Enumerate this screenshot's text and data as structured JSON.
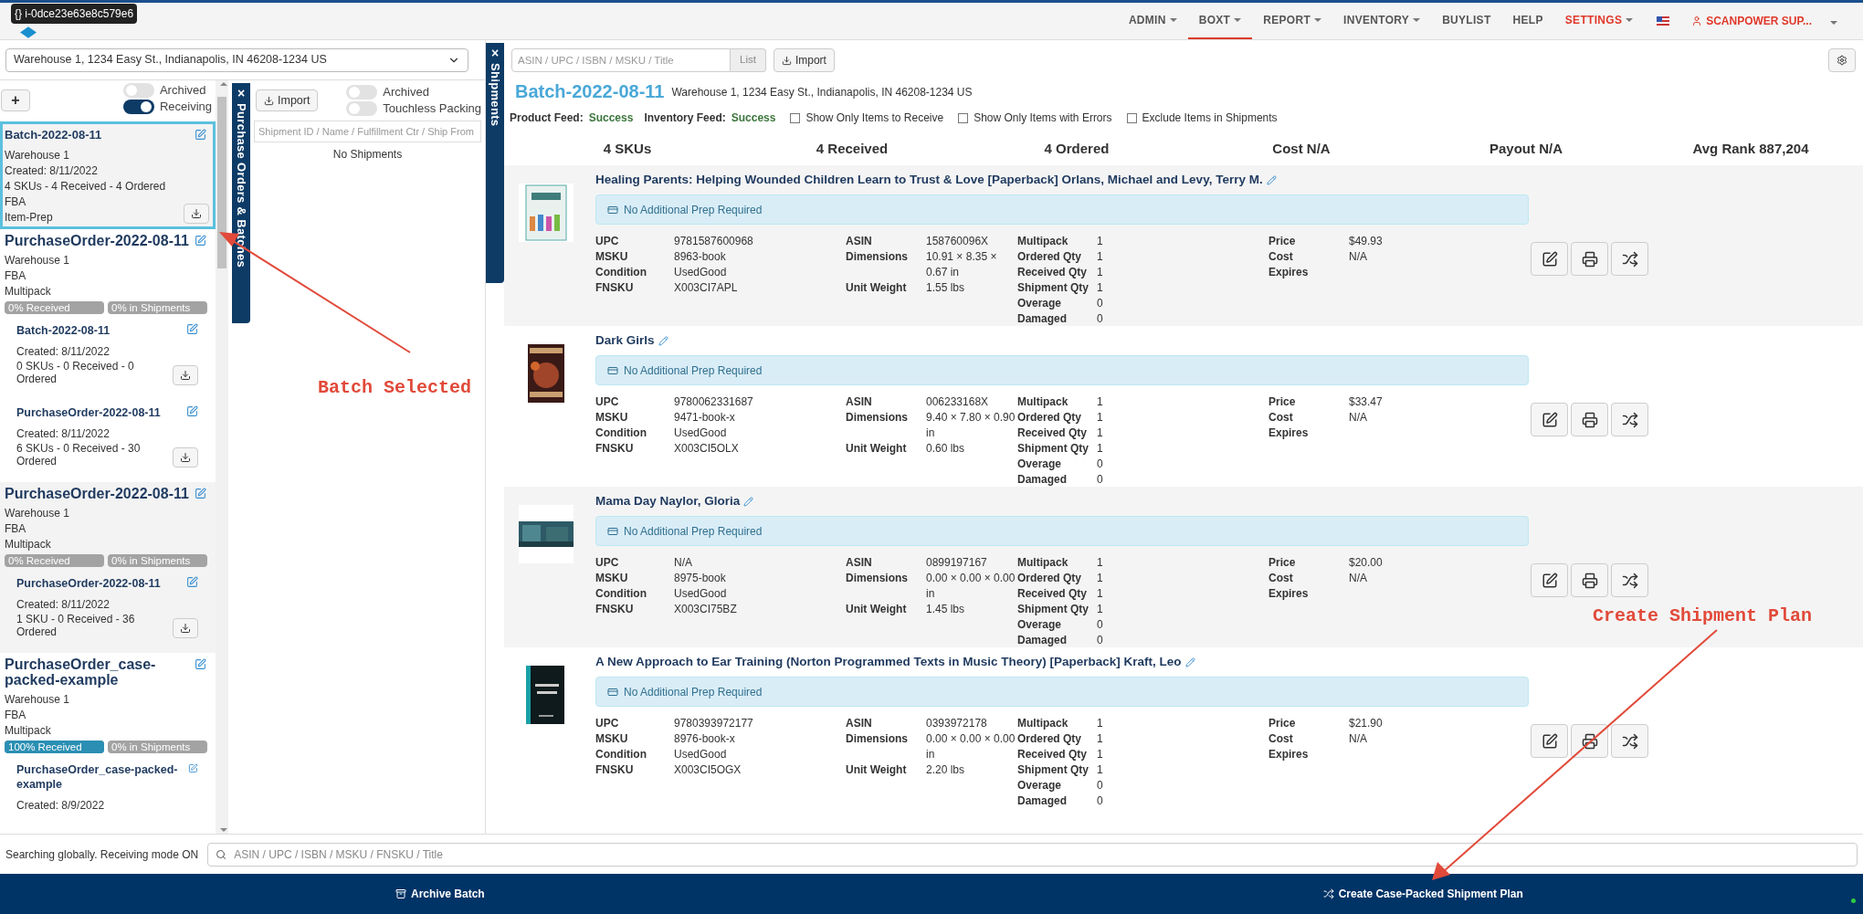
{
  "tooltip": "{} i-0dce23e63e8c579e6",
  "nav": {
    "menus": [
      {
        "label": "ADMIN",
        "dropdown": true,
        "selected": false,
        "color": "#555555"
      },
      {
        "label": "BOXT",
        "dropdown": true,
        "selected": true,
        "color": "#555555"
      },
      {
        "label": "REPORT",
        "dropdown": true,
        "selected": false,
        "color": "#555555"
      },
      {
        "label": "INVENTORY",
        "dropdown": true,
        "selected": false,
        "color": "#555555"
      },
      {
        "label": "BUYLIST",
        "dropdown": false,
        "selected": false,
        "color": "#555555"
      },
      {
        "label": "HELP",
        "dropdown": false,
        "selected": false,
        "color": "#555555"
      },
      {
        "label": "SETTINGS",
        "dropdown": true,
        "selected": false,
        "color": "#e0392b"
      }
    ],
    "user": {
      "label": "SCANPOWER SUP...",
      "dropdown": true
    }
  },
  "warehouse_select": {
    "value": "Warehouse 1, 1234 Easy St., Indianapolis, IN 46208-1234 US"
  },
  "po_panel": {
    "add_button": "+",
    "toggles": [
      {
        "label": "Archived",
        "on": false
      },
      {
        "label": "Receiving",
        "on": true
      }
    ],
    "tab_close": "×",
    "tab_label": "Purchase Orders & Batches",
    "items": [
      {
        "title": "Batch-2022-08-11",
        "selected": true,
        "lines": [
          "Warehouse 1",
          "Created: 8/11/2022",
          "4 SKUs - 4 Received - 4 Ordered",
          "FBA",
          "Item-Prep"
        ],
        "download": true
      },
      {
        "title": "PurchaseOrder-2022-08-11",
        "selected": false,
        "lines": [
          "Warehouse 1",
          "FBA",
          "Multipack"
        ],
        "progress": [
          {
            "label": "0% Received",
            "level": 0
          },
          {
            "label": "0% in Shipments",
            "level": 0
          }
        ],
        "children": [
          {
            "title": "Batch-2022-08-11",
            "lines": [
              "Created: 8/11/2022",
              "0 SKUs - 0 Received - 0 Ordered"
            ],
            "download": true
          },
          {
            "title": "PurchaseOrder-2022-08-11",
            "lines": [
              "Created: 8/11/2022",
              "6 SKUs - 0 Received - 30 Ordered"
            ],
            "download": true
          }
        ]
      },
      {
        "title": "PurchaseOrder-2022-08-11",
        "selected": false,
        "lines": [
          "Warehouse 1",
          "FBA",
          "Multipack"
        ],
        "progress": [
          {
            "label": "0% Received",
            "level": 0
          },
          {
            "label": "0% in Shipments",
            "level": 0
          }
        ],
        "children": [
          {
            "title": "PurchaseOrder-2022-08-11",
            "lines": [
              "Created: 8/11/2022",
              "1 SKU - 0 Received - 36 Ordered"
            ],
            "download": true
          }
        ]
      },
      {
        "title": "PurchaseOrder_case-packed-example",
        "selected": false,
        "lines": [
          "Warehouse 1",
          "FBA",
          "Multipack"
        ],
        "progress": [
          {
            "label": "100% Received",
            "level": 1
          },
          {
            "label": "0% in Shipments",
            "level": 0
          }
        ],
        "children": [
          {
            "title": "PurchaseOrder_case-packed-example",
            "lines": [
              "Created: 8/9/2022"
            ],
            "download": false
          }
        ]
      }
    ]
  },
  "shipments_panel": {
    "import_button": "Import",
    "toggles": [
      {
        "label": "Archived",
        "on": false
      },
      {
        "label": "Touchless Packing",
        "on": false
      }
    ],
    "search": {
      "placeholder": "Shipment ID / Name / Fulfillment Ctr / Ship From"
    },
    "empty": "No Shipments",
    "tab_close": "×",
    "tab_label": "Shipments"
  },
  "toolbar": {
    "search": {
      "placeholder": "ASIN / UPC / ISBN / MSKU / Title"
    },
    "list_button": "List",
    "import_button": "Import"
  },
  "batch": {
    "title": "Batch-2022-08-11",
    "address": "Warehouse 1, 1234 Easy St., Indianapolis, IN 46208-1234 US",
    "feeds": [
      {
        "label": "Product Feed:",
        "value": "Success"
      },
      {
        "label": "Inventory Feed:",
        "value": "Success"
      }
    ],
    "filters": [
      {
        "label": "Show Only Items to Receive",
        "checked": false
      },
      {
        "label": "Show Only Items with Errors",
        "checked": false
      },
      {
        "label": "Exclude Items in Shipments",
        "checked": false
      }
    ],
    "stats": [
      "4 SKUs",
      "4 Received",
      "4 Ordered",
      "Cost N/A",
      "Payout N/A",
      "Avg Rank 887,204"
    ]
  },
  "items": [
    {
      "title": "Healing Parents: Helping Wounded Children Learn to Trust & Love [Paperback] Orlans, Michael and Levy, Terry M.",
      "prep": "No Additional Prep Required",
      "columns": [
        [
          {
            "label": "UPC",
            "value": "9781587600968"
          },
          {
            "label": "MSKU",
            "value": "8963-book"
          },
          {
            "label": "Condition",
            "value": "UsedGood"
          },
          {
            "label": "FNSKU",
            "value": "X003CI7APL"
          }
        ],
        [
          {
            "label": "ASIN",
            "value": "158760096X"
          },
          {
            "label": "Dimensions",
            "value": "10.91 × 8.35 × 0.67 in"
          },
          {
            "label": "Unit Weight",
            "value": "1.55 lbs"
          }
        ],
        [
          {
            "label": "Multipack",
            "value": "1"
          },
          {
            "label": "Ordered Qty",
            "value": "1"
          },
          {
            "label": "Received Qty",
            "value": "1"
          },
          {
            "label": "Shipment Qty",
            "value": "1"
          },
          {
            "label": "Overage",
            "value": "0"
          },
          {
            "label": "Damaged",
            "value": "0"
          }
        ],
        [
          {
            "label": "Price",
            "value": "$49.93"
          },
          {
            "label": "Cost",
            "value": "N/A"
          },
          {
            "label": "Expires"
          }
        ]
      ]
    },
    {
      "title": "Dark Girls",
      "prep": "No Additional Prep Required",
      "columns": [
        [
          {
            "label": "UPC",
            "value": "9780062331687"
          },
          {
            "label": "MSKU",
            "value": "9471-book-x"
          },
          {
            "label": "Condition",
            "value": "UsedGood"
          },
          {
            "label": "FNSKU",
            "value": "X003CI5OLX"
          }
        ],
        [
          {
            "label": "ASIN",
            "value": "006233168X"
          },
          {
            "label": "Dimensions",
            "value": "9.40 × 7.80 × 0.90 in"
          },
          {
            "label": "Unit Weight",
            "value": "0.60 lbs"
          }
        ],
        [
          {
            "label": "Multipack",
            "value": "1"
          },
          {
            "label": "Ordered Qty",
            "value": "1"
          },
          {
            "label": "Received Qty",
            "value": "1"
          },
          {
            "label": "Shipment Qty",
            "value": "1"
          },
          {
            "label": "Overage",
            "value": "0"
          },
          {
            "label": "Damaged",
            "value": "0"
          }
        ],
        [
          {
            "label": "Price",
            "value": "$33.47"
          },
          {
            "label": "Cost",
            "value": "N/A"
          },
          {
            "label": "Expires"
          }
        ]
      ]
    },
    {
      "title": "Mama Day Naylor, Gloria",
      "prep": "No Additional Prep Required",
      "columns": [
        [
          {
            "label": "UPC",
            "value": "N/A"
          },
          {
            "label": "MSKU",
            "value": "8975-book"
          },
          {
            "label": "Condition",
            "value": "UsedGood"
          },
          {
            "label": "FNSKU",
            "value": "X003CI75BZ"
          }
        ],
        [
          {
            "label": "ASIN",
            "value": "0899197167"
          },
          {
            "label": "Dimensions",
            "value": "0.00 × 0.00 × 0.00 in"
          },
          {
            "label": "Unit Weight",
            "value": "1.45 lbs"
          }
        ],
        [
          {
            "label": "Multipack",
            "value": "1"
          },
          {
            "label": "Ordered Qty",
            "value": "1"
          },
          {
            "label": "Received Qty",
            "value": "1"
          },
          {
            "label": "Shipment Qty",
            "value": "1"
          },
          {
            "label": "Overage",
            "value": "0"
          },
          {
            "label": "Damaged",
            "value": "0"
          }
        ],
        [
          {
            "label": "Price",
            "value": "$20.00"
          },
          {
            "label": "Cost",
            "value": "N/A"
          },
          {
            "label": "Expires"
          }
        ]
      ]
    },
    {
      "title": "A New Approach to Ear Training (Norton Programmed Texts in Music Theory) [Paperback] Kraft, Leo",
      "prep": "No Additional Prep Required",
      "columns": [
        [
          {
            "label": "UPC",
            "value": "9780393972177"
          },
          {
            "label": "MSKU",
            "value": "8976-book-x"
          },
          {
            "label": "Condition",
            "value": "UsedGood"
          },
          {
            "label": "FNSKU",
            "value": "X003CI5OGX"
          }
        ],
        [
          {
            "label": "ASIN",
            "value": "0393972178"
          },
          {
            "label": "Dimensions",
            "value": "0.00 × 0.00 × 0.00 in"
          },
          {
            "label": "Unit Weight",
            "value": "2.20 lbs"
          }
        ],
        [
          {
            "label": "Multipack",
            "value": "1"
          },
          {
            "label": "Ordered Qty",
            "value": "1"
          },
          {
            "label": "Received Qty",
            "value": "1"
          },
          {
            "label": "Shipment Qty",
            "value": "1"
          },
          {
            "label": "Overage",
            "value": "0"
          },
          {
            "label": "Damaged",
            "value": "0"
          }
        ],
        [
          {
            "label": "Price",
            "value": "$21.90"
          },
          {
            "label": "Cost",
            "value": "N/A"
          },
          {
            "label": "Expires"
          }
        ]
      ]
    }
  ],
  "footer_search": {
    "status": "Searching globally. Receiving mode ON",
    "placeholder": "ASIN / UPC / ISBN / MSKU / FNSKU / Title"
  },
  "bottom_bar": {
    "buttons": [
      {
        "label": "Archive Batch",
        "kind": "archive"
      },
      {
        "label": "Create Case-Packed Shipment Plan",
        "kind": "shuffle"
      }
    ]
  },
  "annotations": [
    "Batch Selected",
    "Create Shipment Plan"
  ]
}
